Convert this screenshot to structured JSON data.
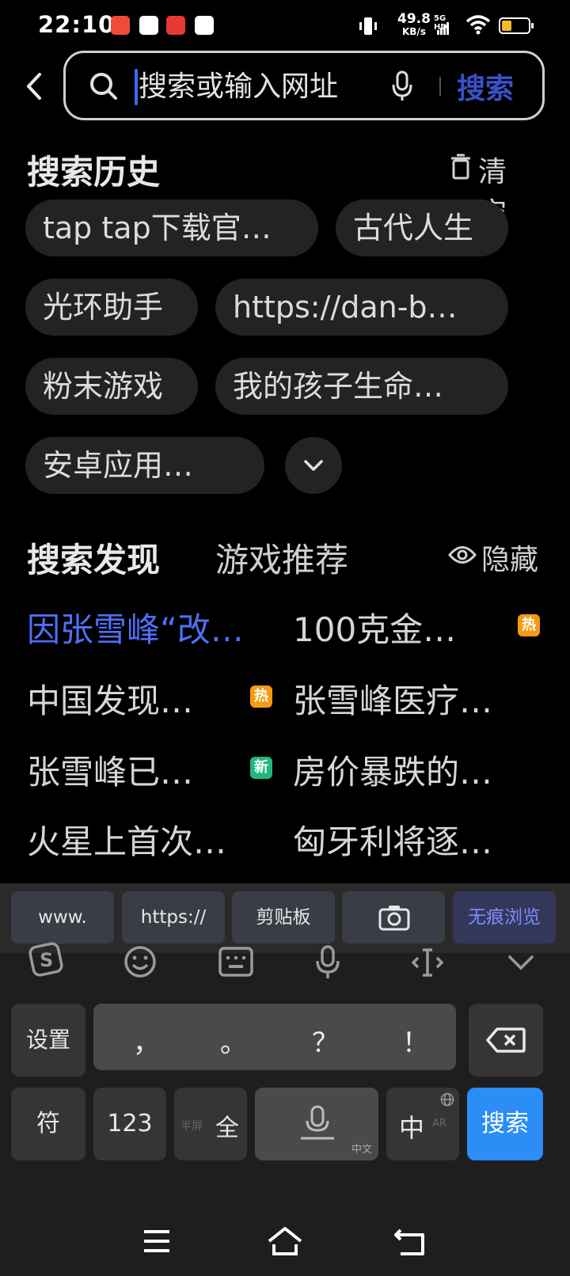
{
  "status": {
    "time": "22:10",
    "net_speed": "49.8",
    "net_unit": "KB/s",
    "net_type": "5G HD",
    "battery_color": "#f5b92a"
  },
  "search": {
    "placeholder": "搜索或输入网址",
    "button_label": "搜索",
    "caret_color": "#3d6bff"
  },
  "history": {
    "title": "搜索历史",
    "clear_label": "清空",
    "items": [
      "tap tap下载官…",
      "古代人生",
      "光环助手",
      "https://dan-b…",
      "粉末游戏",
      "我的孩子生命…",
      "安卓应用…"
    ]
  },
  "discover": {
    "title": "搜索发现",
    "tab2": "游戏推荐",
    "hide_label": "隐藏",
    "items": [
      {
        "text": "因张雪峰“改…",
        "badge": ""
      },
      {
        "text": "100克金…",
        "badge": "热"
      },
      {
        "text": "中国发现…",
        "badge": "热"
      },
      {
        "text": "张雪峰医疗…",
        "badge": ""
      },
      {
        "text": "张雪峰已…",
        "badge": "新"
      },
      {
        "text": "房价暴跌的…",
        "badge": ""
      },
      {
        "text": "火星上首次…",
        "badge": ""
      },
      {
        "text": "匈牙利将逐…",
        "badge": ""
      }
    ]
  },
  "keyboard": {
    "quick": [
      "www.",
      "https://",
      "剪贴板",
      "",
      "无痕浏览"
    ],
    "punct": [
      "，",
      "。",
      "？",
      "！"
    ],
    "settings": "设置",
    "symbols": "符",
    "numbers": "123",
    "half_full_small": "半屏",
    "full": "全",
    "voice_small": "中文",
    "lang": "中",
    "lang_small": "AR",
    "search": "搜索"
  }
}
